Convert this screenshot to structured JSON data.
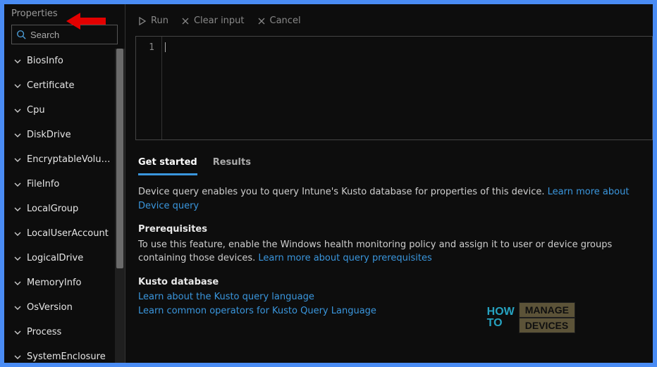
{
  "sidebar": {
    "title": "Properties",
    "search_placeholder": "Search",
    "items": [
      {
        "label": "BiosInfo"
      },
      {
        "label": "Certificate"
      },
      {
        "label": "Cpu"
      },
      {
        "label": "DiskDrive"
      },
      {
        "label": "EncryptableVolu…"
      },
      {
        "label": "FileInfo"
      },
      {
        "label": "LocalGroup"
      },
      {
        "label": "LocalUserAccount"
      },
      {
        "label": "LogicalDrive"
      },
      {
        "label": "MemoryInfo"
      },
      {
        "label": "OsVersion"
      },
      {
        "label": "Process"
      },
      {
        "label": "SystemEnclosure"
      }
    ]
  },
  "toolbar": {
    "run": "Run",
    "clear": "Clear input",
    "cancel": "Cancel"
  },
  "editor": {
    "gutter_line": "1"
  },
  "tabs": {
    "get_started": "Get started",
    "results": "Results"
  },
  "content": {
    "intro_text": "Device query enables you to query Intune's Kusto database for properties of this device. ",
    "intro_link": "Learn more about Device query",
    "prereq_heading": "Prerequisites",
    "prereq_text": "To use this feature, enable the Windows health monitoring policy and assign it to user or device groups containing those devices. ",
    "prereq_link": "Learn more about query prerequisites",
    "kusto_heading": "Kusto database",
    "kusto_link1": "Learn about the Kusto query language",
    "kusto_link2": "Learn common operators for Kusto Query Language"
  },
  "watermark": {
    "how": "HOW",
    "to": "TO",
    "manage": "MANAGE",
    "devices": "DEVICES"
  }
}
